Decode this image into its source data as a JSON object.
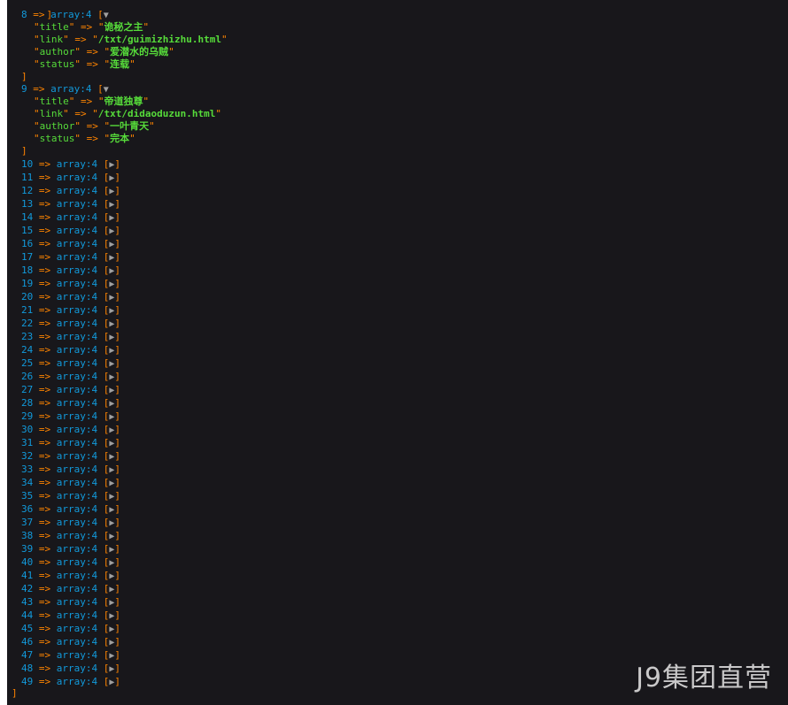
{
  "colors": {
    "background": "#18171b",
    "number": "#1299da",
    "arrow": "#ff8400",
    "string": "#56db3a",
    "toggle": "#a0a0a0"
  },
  "icons": {
    "expanded": "expanded-toggle-icon",
    "collapsed": "collapsed-toggle-icon"
  },
  "dump": {
    "arrow": "=>",
    "type_label": "array:4",
    "expanded_glyph": "▼",
    "collapsed_glyph": "▶",
    "open_bracket": "[",
    "close_bracket": "]",
    "top_close_bracket": "]",
    "final_close_bracket": "]",
    "expanded_items": [
      {
        "index": "8",
        "fields": [
          {
            "key": "title",
            "value": "诡秘之主"
          },
          {
            "key": "link",
            "value": "/txt/guimizhizhu.html"
          },
          {
            "key": "author",
            "value": "爱潜水的乌贼"
          },
          {
            "key": "status",
            "value": "连载"
          }
        ]
      },
      {
        "index": "9",
        "fields": [
          {
            "key": "title",
            "value": "帝道独尊"
          },
          {
            "key": "link",
            "value": "/txt/didaoduzun.html"
          },
          {
            "key": "author",
            "value": "一叶青天"
          },
          {
            "key": "status",
            "value": "完本"
          }
        ]
      }
    ],
    "collapsed_items": [
      "10",
      "11",
      "12",
      "13",
      "14",
      "15",
      "16",
      "17",
      "18",
      "19",
      "20",
      "21",
      "22",
      "23",
      "24",
      "25",
      "26",
      "27",
      "28",
      "29",
      "30",
      "31",
      "32",
      "33",
      "34",
      "35",
      "36",
      "37",
      "38",
      "39",
      "40",
      "41",
      "42",
      "43",
      "44",
      "45",
      "46",
      "47",
      "48",
      "49"
    ]
  },
  "watermark": "J9集团直营"
}
